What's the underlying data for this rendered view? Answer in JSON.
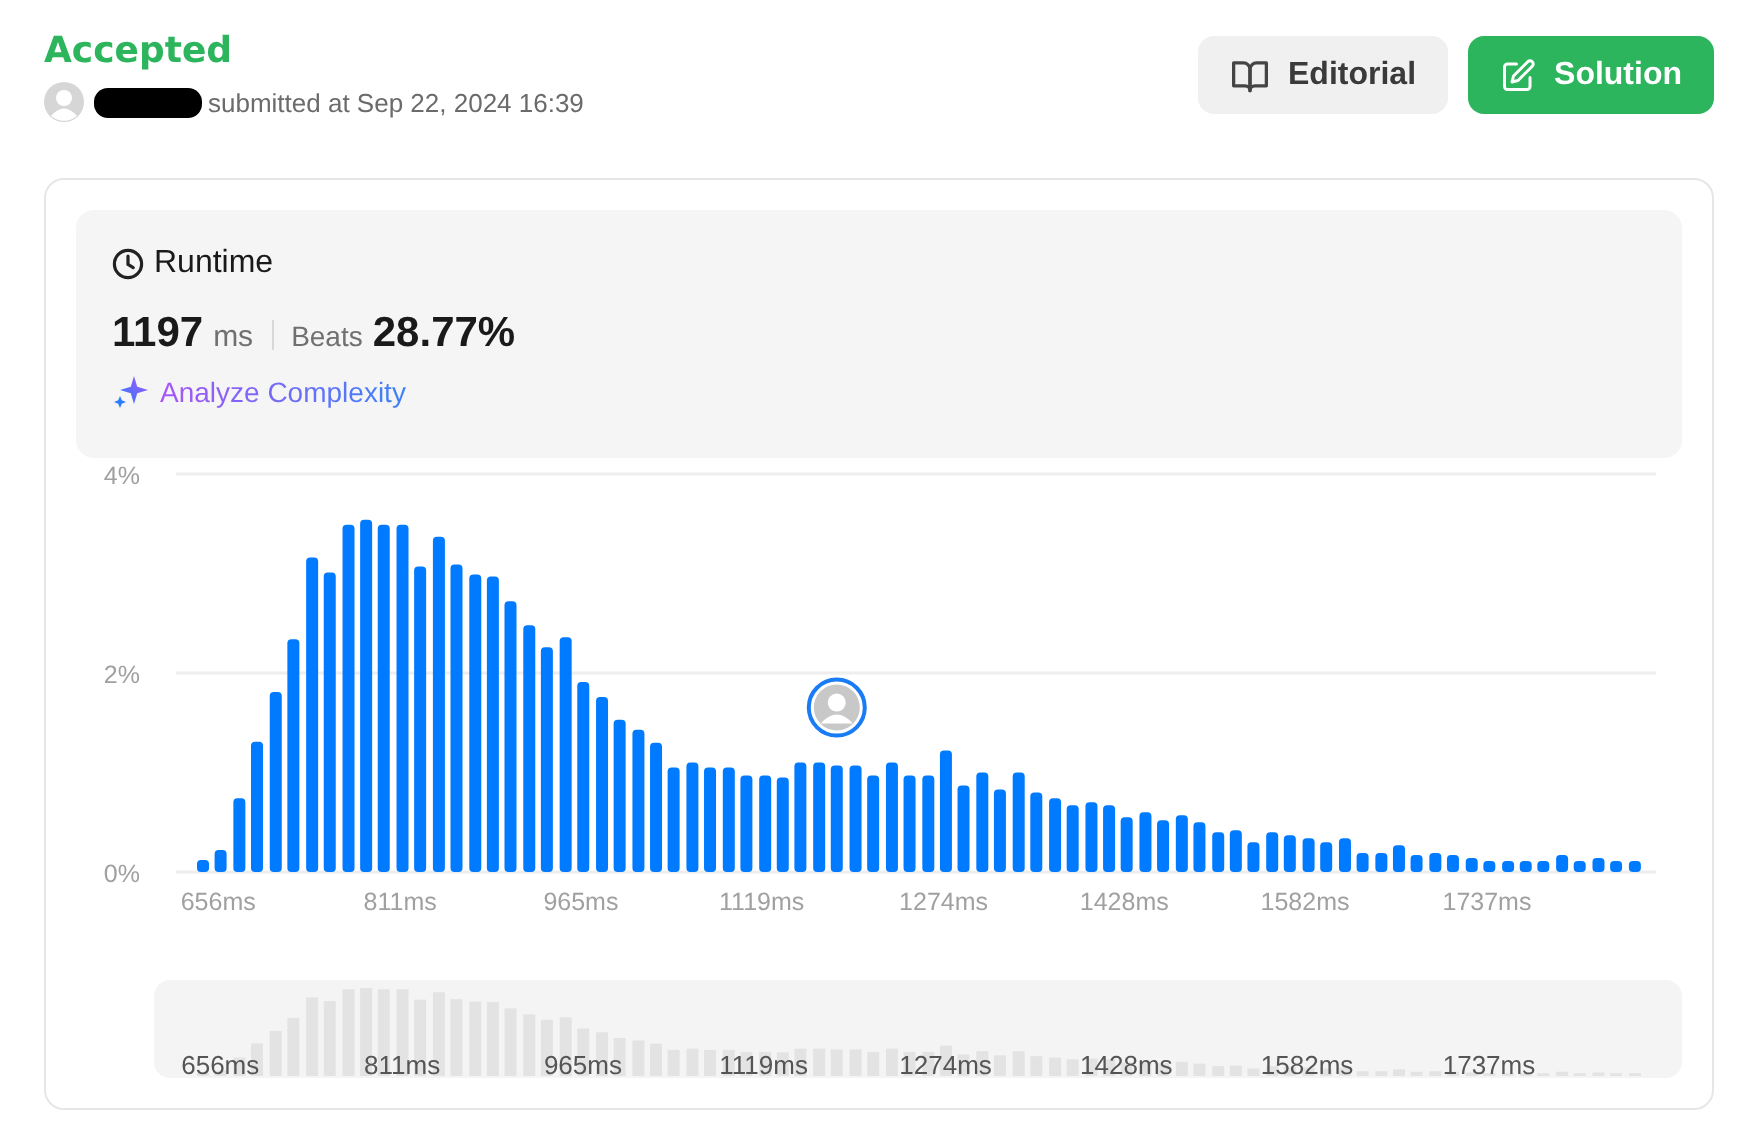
{
  "header": {
    "status": "Accepted",
    "submitted": "submitted at Sep 22, 2024 16:39"
  },
  "buttons": [
    {
      "label": "Editorial",
      "kind": "secondary"
    },
    {
      "label": "Solution",
      "kind": "primary"
    }
  ],
  "runtime": {
    "title": "Runtime",
    "value": "1197",
    "unit": "ms",
    "beats_label": "Beats",
    "beats_value": "28.77%",
    "analyze_link": "Analyze Complexity"
  },
  "chart_data": {
    "type": "bar",
    "xlim": [
      620,
      1881
    ],
    "ylim": [
      0,
      4
    ],
    "yticks": [
      {
        "value": 0,
        "label": "0%"
      },
      {
        "value": 2,
        "label": "2%"
      },
      {
        "value": 4,
        "label": "4%"
      }
    ],
    "xticks": [
      {
        "value": 656,
        "label": "656ms"
      },
      {
        "value": 811,
        "label": "811ms"
      },
      {
        "value": 965,
        "label": "965ms"
      },
      {
        "value": 1119,
        "label": "1119ms"
      },
      {
        "value": 1274,
        "label": "1274ms"
      },
      {
        "value": 1428,
        "label": "1428ms"
      },
      {
        "value": 1582,
        "label": "1582ms"
      },
      {
        "value": 1737,
        "label": "1737ms"
      }
    ],
    "x": [
      643,
      658,
      674,
      689,
      705,
      720,
      736,
      751,
      767,
      782,
      797,
      813,
      828,
      844,
      859,
      875,
      890,
      905,
      921,
      936,
      952,
      967,
      983,
      998,
      1014,
      1029,
      1044,
      1060,
      1075,
      1091,
      1106,
      1122,
      1137,
      1152,
      1168,
      1183,
      1199,
      1214,
      1230,
      1245,
      1261,
      1276,
      1291,
      1307,
      1322,
      1338,
      1353,
      1369,
      1384,
      1400,
      1415,
      1430,
      1446,
      1461,
      1477,
      1492,
      1508,
      1523,
      1538,
      1554,
      1569,
      1585,
      1600,
      1616,
      1631,
      1647,
      1662,
      1677,
      1693,
      1708,
      1724,
      1739,
      1755,
      1770,
      1785,
      1801,
      1816,
      1832,
      1847,
      1863
    ],
    "series": [
      {
        "color": "#007bff",
        "values": [
          0.12,
          0.22,
          0.74,
          1.31,
          1.81,
          2.34,
          3.16,
          3.01,
          3.49,
          3.54,
          3.49,
          3.49,
          3.07,
          3.37,
          3.09,
          2.99,
          2.97,
          2.72,
          2.48,
          2.26,
          2.36,
          1.91,
          1.76,
          1.53,
          1.43,
          1.3,
          1.05,
          1.1,
          1.05,
          1.05,
          0.97,
          0.97,
          0.95,
          1.1,
          1.1,
          1.07,
          1.07,
          0.97,
          1.1,
          0.97,
          0.97,
          1.22,
          0.87,
          1.0,
          0.83,
          1.0,
          0.8,
          0.74,
          0.67,
          0.7,
          0.67,
          0.55,
          0.6,
          0.52,
          0.57,
          0.5,
          0.4,
          0.42,
          0.3,
          0.4,
          0.37,
          0.34,
          0.3,
          0.34,
          0.19,
          0.19,
          0.27,
          0.17,
          0.19,
          0.17,
          0.14,
          0.11,
          0.11,
          0.11,
          0.11,
          0.17,
          0.11,
          0.14,
          0.11,
          0.11
        ]
      }
    ]
  },
  "navigator": {
    "labels": [
      "656ms",
      "811ms",
      "965ms",
      "1119ms",
      "1274ms",
      "1428ms",
      "1582ms",
      "1737ms"
    ]
  }
}
